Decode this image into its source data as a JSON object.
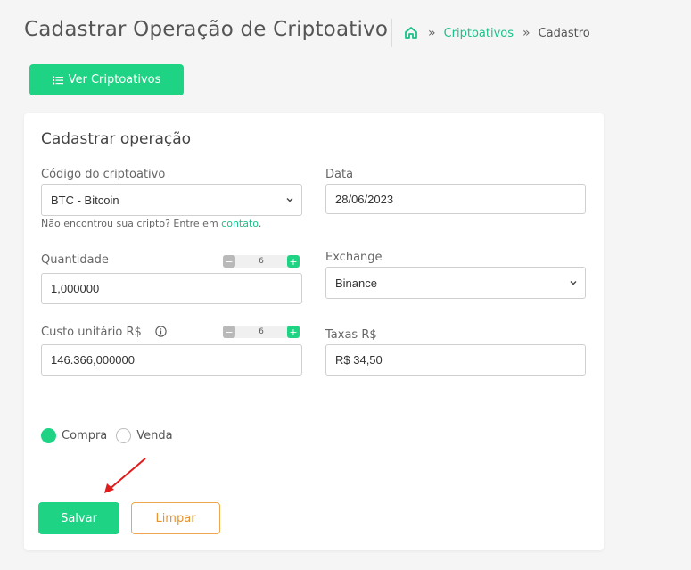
{
  "header": {
    "title": "Cadastrar Operação de Criptoativo",
    "breadcrumb": {
      "separator": "»",
      "link": "Criptoativos",
      "current": "Cadastro"
    }
  },
  "top_button": {
    "label": "Ver Criptoativos"
  },
  "form": {
    "title": "Cadastrar operação",
    "crypto": {
      "label": "Código do criptoativo",
      "value": "BTC - Bitcoin",
      "hint_text": "Não encontrou sua cripto? Entre em ",
      "hint_link": "contato",
      "hint_end": "."
    },
    "date": {
      "label": "Data",
      "value": "28/06/2023"
    },
    "quantity": {
      "label": "Quantidade",
      "value": "1,000000",
      "decimals": {
        "minus": "−",
        "value": "6",
        "plus": "+"
      }
    },
    "exchange": {
      "label": "Exchange",
      "value": "Binance"
    },
    "unit_cost": {
      "label": "Custo unitário R$",
      "value": "146.366,000000",
      "decimals": {
        "minus": "−",
        "value": "6",
        "plus": "+"
      }
    },
    "fees": {
      "label": "Taxas R$",
      "value": "R$ 34,50"
    },
    "operation_type": {
      "options": [
        {
          "label": "Compra",
          "selected": true
        },
        {
          "label": "Venda",
          "selected": false
        }
      ]
    },
    "save_label": "Salvar",
    "clear_label": "Limpar"
  },
  "colors": {
    "accent": "#1ed484",
    "link": "#1cc08a",
    "clear_border": "#f0a64c",
    "annotation_arrow": "#e01b1b"
  }
}
